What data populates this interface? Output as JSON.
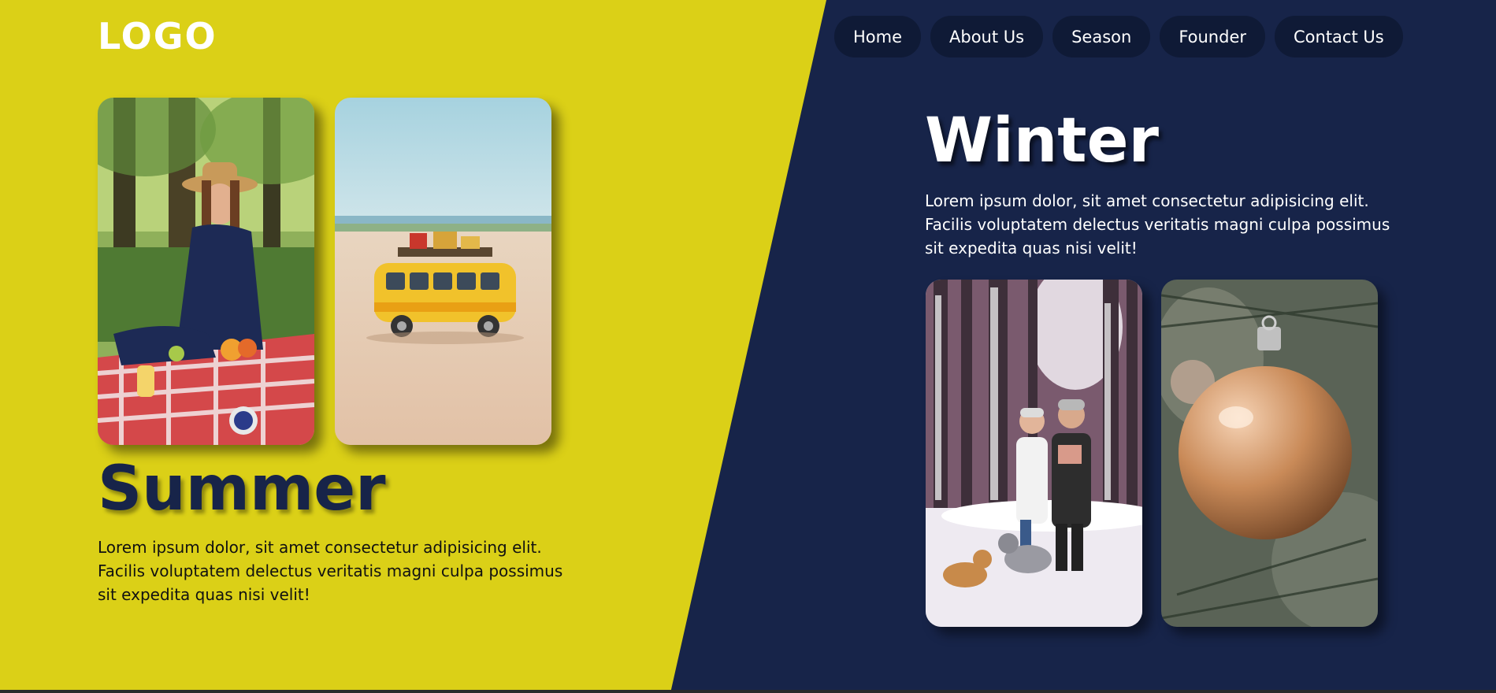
{
  "brand": {
    "logo": "LOGO"
  },
  "nav": {
    "items": [
      "Home",
      "About Us",
      "Season",
      "Founder",
      "Contact Us"
    ]
  },
  "summer": {
    "title": "Summer",
    "text": "Lorem ipsum dolor, sit amet consectetur adipisicing elit. Facilis voluptatem delectus veritatis magni culpa possimus sit expedita quas nisi velit!"
  },
  "winter": {
    "title": "Winter",
    "text": "Lorem ipsum dolor, sit amet consectetur adipisicing elit. Facilis voluptatem delectus veritatis magni culpa possimus sit expedita quas nisi velit!"
  },
  "colors": {
    "summer_bg": "#dbd017",
    "winter_bg": "#172449",
    "nav_pill": "#0f1a36"
  }
}
